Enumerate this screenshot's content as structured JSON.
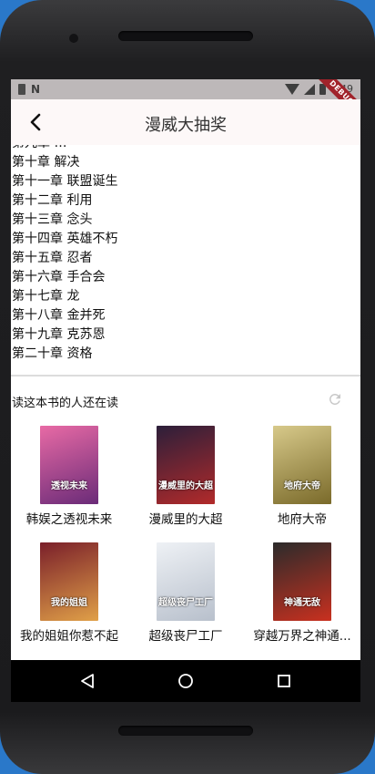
{
  "status_bar": {
    "time": "9:49",
    "debug_label": "DEBUG",
    "n_icon": "N"
  },
  "app_bar": {
    "title": "漫威大抽奖"
  },
  "chapters": [
    "第九章 …",
    "第十章 解决",
    "第十一章 联盟诞生",
    "第十二章 利用",
    "第十三章 念头",
    "第十四章 英雄不朽",
    "第十五章 忍者",
    "第十六章 手合会",
    "第十七章 龙",
    "第十八章 金并死",
    "第十九章 克苏恩",
    "第二十章 资格"
  ],
  "recommendations": {
    "header": "读这本书的人还在读",
    "books": [
      {
        "title": "韩娱之透视未来",
        "cover_text": "透视未来",
        "colors": [
          "#e86aa5",
          "#6a2b78"
        ]
      },
      {
        "title": "漫威里的大超",
        "cover_text": "漫威里的大超",
        "colors": [
          "#2c1f3a",
          "#b22a2a"
        ]
      },
      {
        "title": "地府大帝",
        "cover_text": "地府大帝",
        "colors": [
          "#d7c98a",
          "#7a6a2a"
        ]
      },
      {
        "title": "我的姐姐你惹不起",
        "cover_text": "我的姐姐",
        "colors": [
          "#7a1f2a",
          "#e0a048"
        ]
      },
      {
        "title": "超级丧尸工厂",
        "cover_text": "超级丧尸工厂",
        "colors": [
          "#eef1f5",
          "#b8c0cc"
        ]
      },
      {
        "title": "穿越万界之神通...",
        "cover_text": "神通无敌",
        "colors": [
          "#2b2b2b",
          "#c9301f"
        ]
      }
    ]
  }
}
